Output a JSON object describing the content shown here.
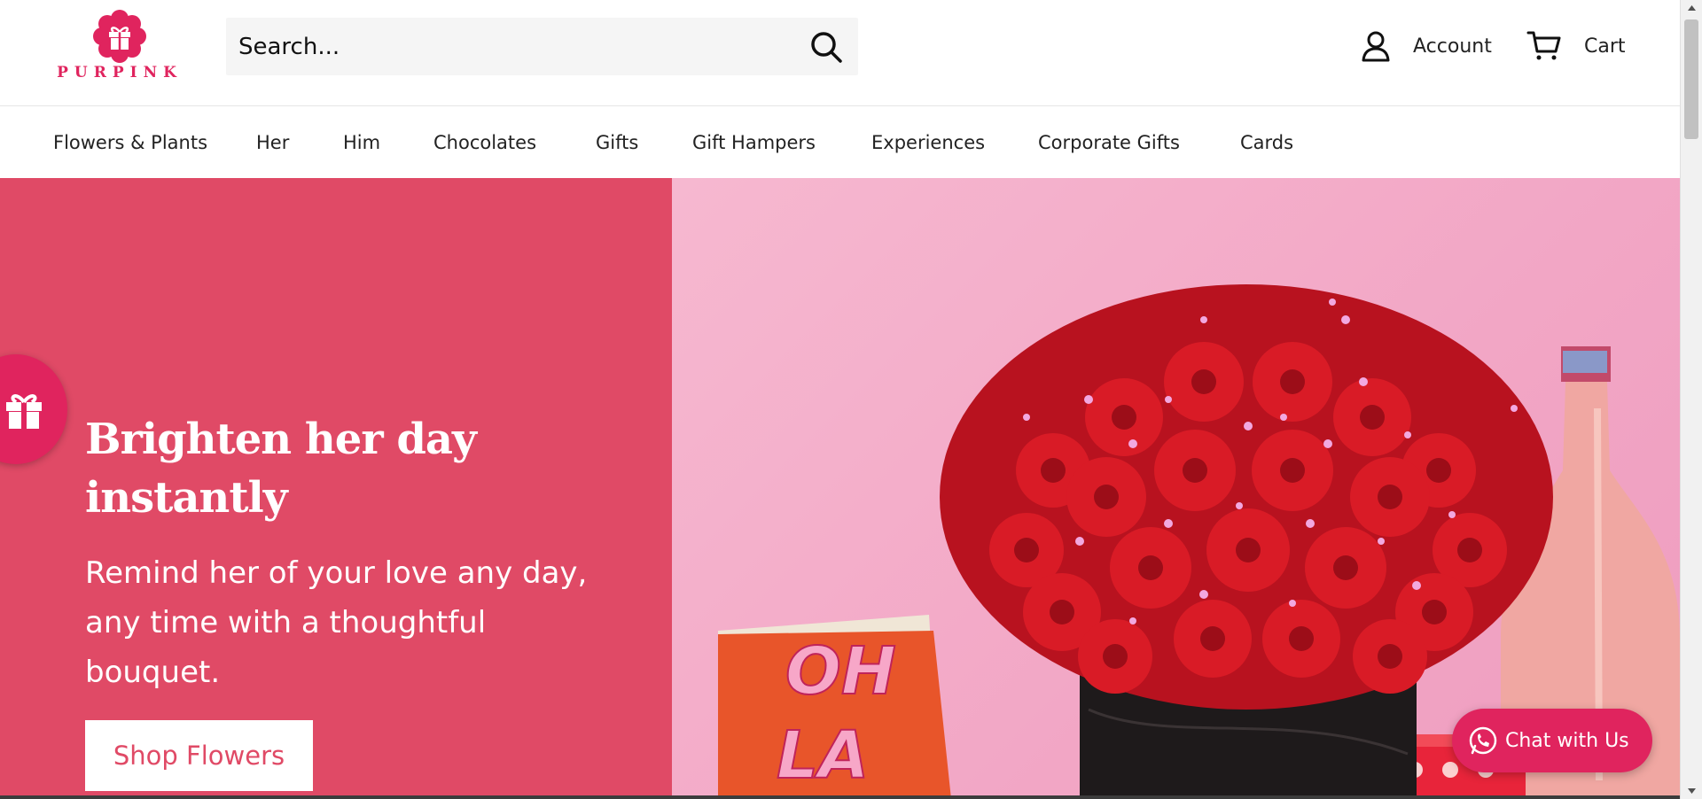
{
  "brand": {
    "name": "PURPINK",
    "accent": "#e0245e",
    "hero_color": "#e04a66"
  },
  "search": {
    "placeholder": "Search..."
  },
  "header": {
    "account_label": "Account",
    "cart_label": "Cart"
  },
  "nav": {
    "items": [
      {
        "label": "Flowers & Plants"
      },
      {
        "label": "Her"
      },
      {
        "label": "Him"
      },
      {
        "label": "Chocolates"
      },
      {
        "label": "Gifts"
      },
      {
        "label": "Gift Hampers"
      },
      {
        "label": "Experiences"
      },
      {
        "label": "Corporate Gifts"
      },
      {
        "label": "Cards"
      }
    ]
  },
  "hero": {
    "title": "Brighten her day instantly",
    "subtitle": "Remind her of your love any day, any time with a thoughtful bouquet.",
    "cta": "Shop Flowers",
    "card_text": "OH LA"
  },
  "chat": {
    "label": "Chat with Us"
  },
  "icons": [
    "gift-icon",
    "search-icon",
    "account-icon",
    "cart-icon",
    "whatsapp-icon"
  ]
}
